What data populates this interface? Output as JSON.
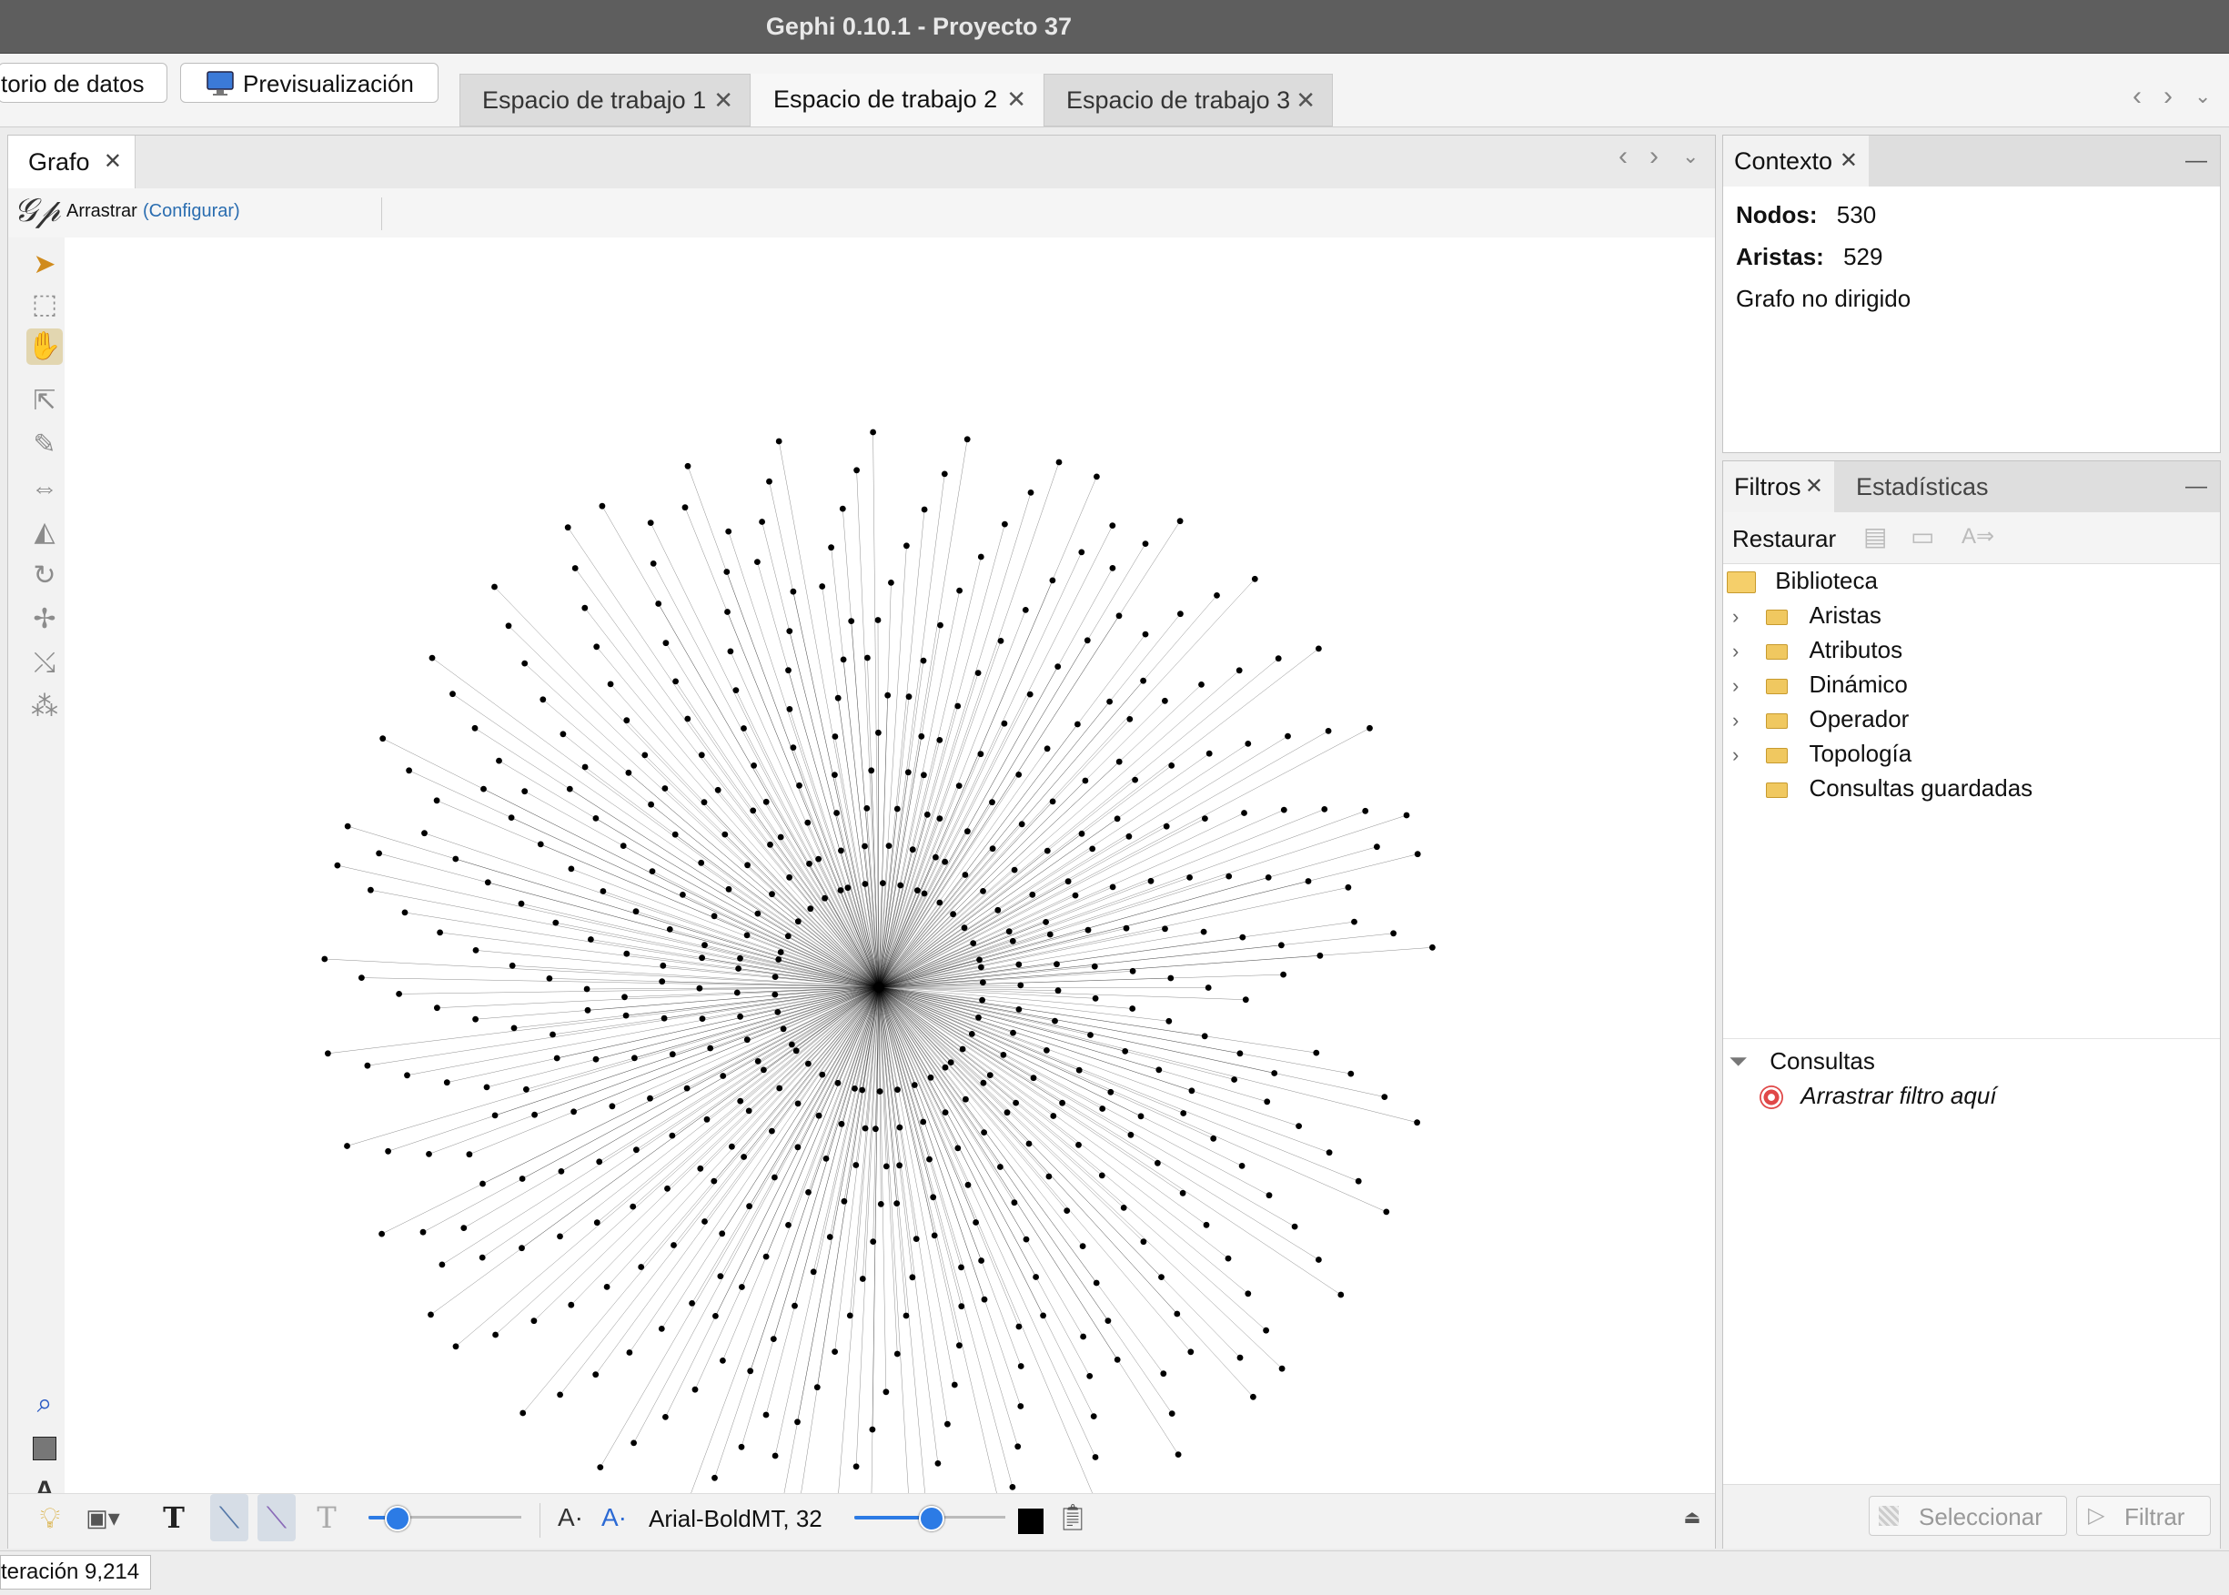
{
  "window": {
    "title": "Gephi 0.10.1 - Proyecto 37"
  },
  "top": {
    "data_lab_label": "torio de datos",
    "preview_label": "Previsualización",
    "workspace_tabs": [
      {
        "label": "Espacio de trabajo 1",
        "active": false
      },
      {
        "label": "Espacio de trabajo 2",
        "active": true
      },
      {
        "label": "Espacio de trabajo 3",
        "active": false
      }
    ]
  },
  "graph_panel": {
    "tab_label": "Grafo",
    "mode_label": "Arrastrar",
    "configure_label": "(Configurar)",
    "font_label": "Arial-BoldMT, 32",
    "text_slider_level": 0.18,
    "font_slider_level": 0.5,
    "text_color": "#000000",
    "graph": {
      "node_count": 530,
      "hub_count": 1,
      "ring_count": 13
    }
  },
  "context_panel": {
    "tab_label": "Contexto",
    "nodes_label": "Nodos:",
    "nodes_value": "530",
    "edges_label": "Aristas:",
    "edges_value": "529",
    "graph_type": "Grafo no dirigido"
  },
  "filters_panel": {
    "tab_filters": "Filtros",
    "tab_statistics": "Estadísticas",
    "reset_label": "Restaurar",
    "library_label": "Biblioteca",
    "library_items": [
      "Aristas",
      "Atributos",
      "Dinámico",
      "Operador",
      "Topología",
      "Consultas guardadas"
    ],
    "queries_label": "Consultas",
    "drop_hint": "Arrastrar filtro aquí",
    "select_button": "Seleccionar",
    "filter_button": "Filtrar"
  },
  "status": {
    "iteration": "teración 9,214"
  },
  "colors": {
    "accent": "#2c7be5",
    "link": "#2a6db0",
    "titlebar": "#5e5e5e"
  }
}
